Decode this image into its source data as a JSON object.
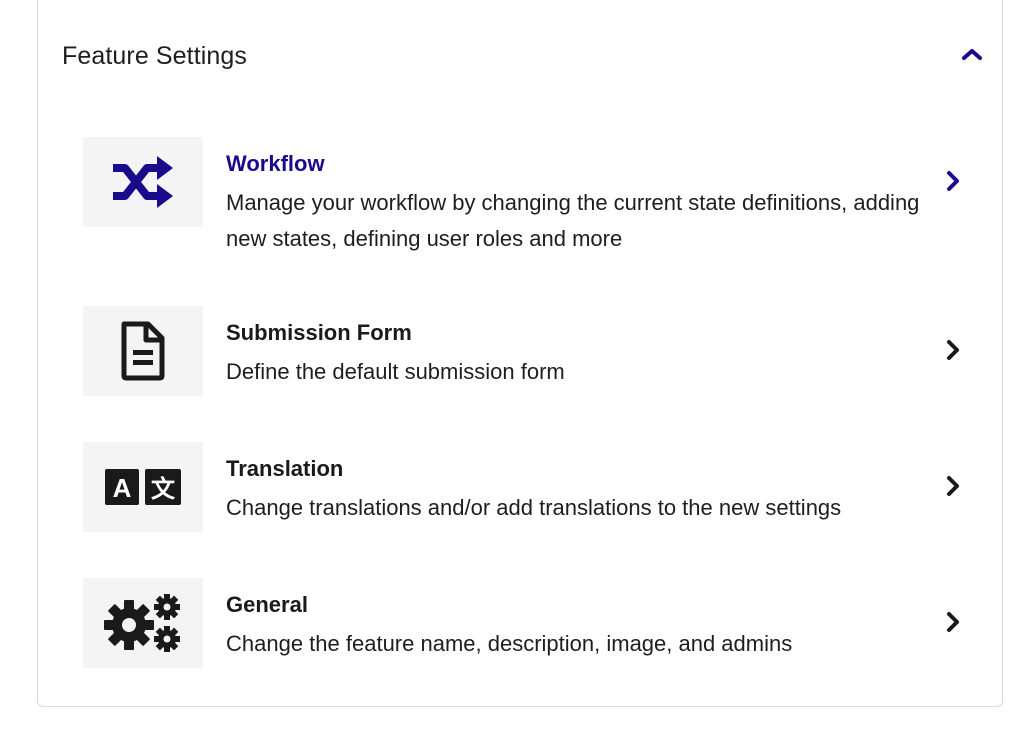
{
  "panel": {
    "title": "Feature Settings",
    "collapse_icon": "chevron-up-icon"
  },
  "items": [
    {
      "key": "workflow",
      "title": "Workflow",
      "description": "Manage your workflow by changing the current state definitions, adding new states, defining user roles and more",
      "icon": "shuffle-icon",
      "active": true
    },
    {
      "key": "submission-form",
      "title": "Submission Form",
      "description": "Define the default submission form",
      "icon": "document-icon",
      "active": false
    },
    {
      "key": "translation",
      "title": "Translation",
      "description": "Change translations and/or add translations to the new settings",
      "icon": "translate-icon",
      "active": false
    },
    {
      "key": "general",
      "title": "General",
      "description": "Change the feature name, description, image, and admins",
      "icon": "gears-icon",
      "active": false
    }
  ],
  "colors": {
    "accent": "#1a0a8c",
    "text": "#1a1a1a",
    "icon_bg": "#f4f4f4",
    "border": "#d9d9d9"
  }
}
